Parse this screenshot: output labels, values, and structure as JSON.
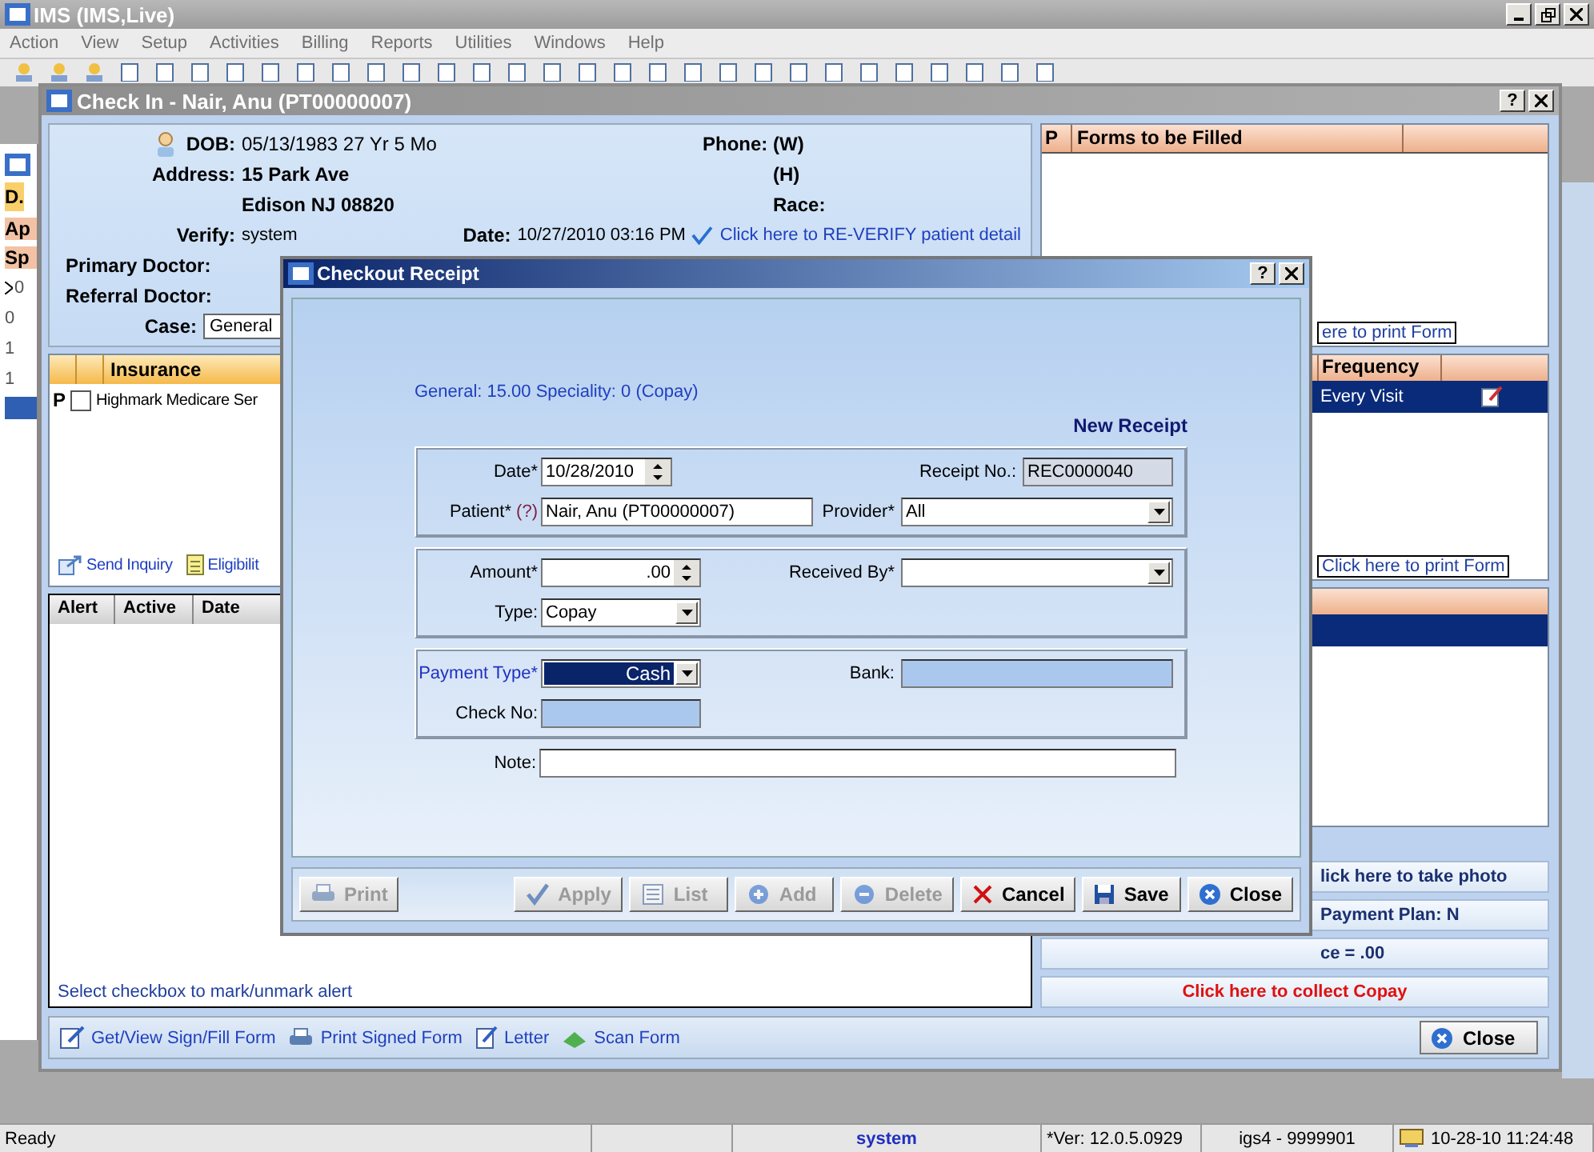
{
  "app": {
    "title": "IMS (IMS,Live)"
  },
  "menu": [
    "Action",
    "View",
    "Setup",
    "Activities",
    "Billing",
    "Reports",
    "Utilities",
    "Windows",
    "Help"
  ],
  "back_window": {
    "tab": "D.",
    "headers": [
      "Ap",
      "Sp"
    ],
    "rows": [
      {
        "text": "0",
        "current": true
      },
      {
        "text": "0",
        "current": false
      },
      {
        "text": "1",
        "current": false
      },
      {
        "text": "1",
        "current": false
      }
    ]
  },
  "checkin": {
    "title": "Check In - Nair, Anu  (PT00000007)",
    "help_button": "?",
    "patient": {
      "dob": {
        "label": "DOB:",
        "value": "05/13/1983  27 Yr 5 Mo"
      },
      "address": {
        "label": "Address:",
        "lines": [
          "15 Park Ave",
          "Edison  NJ  08820"
        ]
      },
      "verify": {
        "label": "Verify:",
        "value": "system"
      },
      "primary_doctor": {
        "label": "Primary Doctor:"
      },
      "referral_doctor": {
        "label": "Referral Doctor:"
      },
      "case": {
        "label": "Case:",
        "value": "General"
      },
      "phone": {
        "label": "Phone:",
        "work": "(W)",
        "home": "(H)"
      },
      "race": {
        "label": "Race:"
      },
      "date": {
        "label": "Date:",
        "value": "10/27/2010 03:16 PM"
      },
      "reverify_link": "Click here to RE-VERIFY patient detail"
    },
    "insurance": {
      "columns": [
        "Insurance"
      ],
      "rows": [
        {
          "priority": "P",
          "checked": false,
          "name": "Highmark Medicare Ser"
        }
      ],
      "links": [
        "Send Inquiry",
        "Eligibilit"
      ]
    },
    "alerts": {
      "columns": [
        "Alert",
        "Active",
        "Date"
      ],
      "hint": "Select checkbox to mark/unmark alert"
    },
    "forms": {
      "columns": [
        "P",
        "Forms to be Filled"
      ],
      "print_link": "ere to print Form"
    },
    "schedule": {
      "columns": [
        "Frequency"
      ],
      "rows": [
        {
          "text": "Every Visit",
          "selected": true
        }
      ],
      "print_link": "Click here to print Form"
    },
    "third_panel": {
      "rows": [
        {
          "selected": true
        }
      ]
    },
    "actions": {
      "photo": "lick here to take photo",
      "payment_plan": "Payment Plan: N",
      "balance": "ce = .00",
      "copay": "Click here to collect Copay"
    },
    "toolbar": [
      "Get/View Sign/Fill Form",
      "Print Signed Form",
      "Letter",
      "Scan Form"
    ],
    "close": "Close"
  },
  "dialog": {
    "title": "Checkout Receipt",
    "help_button": "?",
    "summary": "General: 15.00 Speciality: 0 (Copay)",
    "heading": "New Receipt",
    "date": {
      "label": "Date*",
      "value": "10/28/2010"
    },
    "receipt_no": {
      "label": "Receipt No.:",
      "value": "REC0000040"
    },
    "patient": {
      "label": "Patient*",
      "help": "(?)",
      "value": "Nair, Anu  (PT00000007)"
    },
    "provider": {
      "label": "Provider*",
      "value": "All"
    },
    "amount": {
      "label": "Amount*",
      "value": ".00"
    },
    "received_by": {
      "label": "Received By*"
    },
    "type": {
      "label": "Type:",
      "value": "Copay"
    },
    "payment_type": {
      "label": "Payment Type*",
      "value": "Cash",
      "focused": true
    },
    "bank": {
      "label": "Bank:",
      "disabled": true
    },
    "check_no": {
      "label": "Check No:",
      "disabled": true
    },
    "note": {
      "label": "Note:"
    },
    "left_buttons": [
      {
        "label": "Print",
        "disabled": true
      }
    ],
    "right_buttons": [
      {
        "label": "Apply",
        "disabled": true
      },
      {
        "label": "List",
        "disabled": true
      },
      {
        "label": "Add",
        "disabled": true
      },
      {
        "label": "Delete",
        "disabled": true
      },
      {
        "label": "Cancel",
        "disabled": false
      },
      {
        "label": "Save",
        "disabled": false
      },
      {
        "label": "Close",
        "disabled": false
      }
    ]
  },
  "status_bar": {
    "message": "Ready",
    "user": "system",
    "version": "*Ver: 12.0.5.0929",
    "site": "igs4 - 9999901",
    "clock": "10-28-10 11:24:48"
  }
}
